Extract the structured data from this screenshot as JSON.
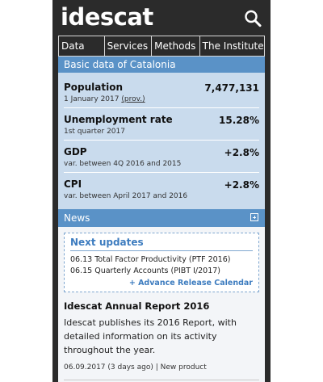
{
  "header": {
    "logo": "idescat",
    "search_icon": "search-icon"
  },
  "nav": {
    "items": [
      {
        "label": "Data"
      },
      {
        "label": "Services"
      },
      {
        "label": "Methods"
      },
      {
        "label": "The Institute"
      }
    ]
  },
  "basic": {
    "title": "Basic data of Catalonia",
    "stats": [
      {
        "title": "Population",
        "value": "7,477,131",
        "sub": "1 January 2017",
        "sub_link": "(prov.)"
      },
      {
        "title": "Unemployment rate",
        "value": "15.28%",
        "sub": "1st quarter 2017",
        "sub_link": ""
      },
      {
        "title": "GDP",
        "value": "+2.8%",
        "sub": "var. between 4Q 2016 and 2015",
        "sub_link": ""
      },
      {
        "title": "CPI",
        "value": "+2.8%",
        "sub": "var. between April 2017 and 2016",
        "sub_link": ""
      }
    ]
  },
  "news": {
    "title": "News",
    "expand_icon": "expand-icon",
    "next_updates": {
      "title": "Next updates",
      "lines": [
        "06.13 Total Factor Productivity (PTF 2016)",
        "06.15 Quarterly Accounts (PIBT I/2017)"
      ],
      "calendar_link": "+ Advance Release Calendar"
    },
    "report": {
      "title": "Idescat Annual Report 2016",
      "text": "Idescat publishes its 2016 Report, with detailed information on its activity throughout the year.",
      "date": "06.09.2017 (3 days ago)",
      "separator": "|",
      "category": "New product"
    }
  },
  "colors": {
    "header_bg": "#2b2b2b",
    "section_head": "#5a92c7",
    "basic_bg": "#c9dbed",
    "link": "#3d7cbf"
  }
}
